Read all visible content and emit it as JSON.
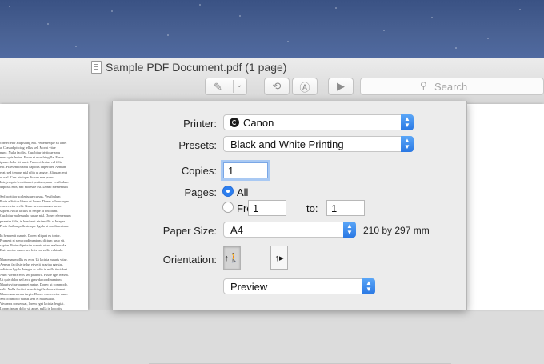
{
  "window": {
    "title": "Sample PDF Document.pdf (1 page)",
    "title_chevron": "⌄"
  },
  "toolbar": {
    "pen_glyph": "✎",
    "pen_chevron": "⌄",
    "rotate_glyph": "⟲",
    "markup_glyph": "Ⓐ",
    "slideshow_glyph": "▶",
    "search_icon": "⚲",
    "search_placeholder": "Search"
  },
  "print": {
    "printer": {
      "label": "Printer:",
      "value": "Canon"
    },
    "presets": {
      "label": "Presets:",
      "value": "Black and White Printing"
    },
    "copies": {
      "label": "Copies:",
      "value": "1"
    },
    "pages": {
      "label": "Pages:",
      "all_label": "All",
      "from_label": "From:",
      "from_value": "1",
      "to_label": "to:",
      "to_value": "1",
      "selected": "All"
    },
    "paper_size": {
      "label": "Paper Size:",
      "value": "A4",
      "dimensions": "210 by 297 mm"
    },
    "orientation": {
      "label": "Orientation:",
      "selected": "portrait"
    },
    "section": {
      "value": "Preview"
    }
  },
  "document_preview": {
    "lines": [
      "consectetur adipiscing elit. Pellentesque sit amet",
      "a. Cras adipiscing tellus vel. Morbi vitae",
      "nunc. Nulla facilisi. Curabitur tristique arcu",
      "nunc quis lectus. Fusce et eros fringilla. Fusce",
      "ipsum dolor sit amet. Fusce et lectus vel felis",
      "elit. Praesent in arcu dapibus imperdiet. Aenean",
      "erat, sed tempus nisl nibh ut augue. Aliquam erat",
      "ut nisl. Cras tristique dictum non purus.",
      "Integer quis leo sit amet pretium, nam vestibulum",
      "dapibus eros, nec molestie est. Donec elementum",
      "",
      "Sed porttitor scelerisque cursus. Vestibulum",
      "Proin efficitur libero ut lorem. Donec ullamcorper",
      "consectetur a elit. Nunc nec accumsan lacus.",
      "sapien. Nulla iaculis ut neque at tincidunt.",
      "Curabitur malesuada cursus nisl. Donec elementum",
      "pharetra felis, in hendrerit nisi mollis a. Integer",
      "Proin finibus pellentesque ligula ut condimentum.",
      "",
      "In hendrerit mauris. Donec aliquet ex tortor.",
      "Praesent et sem condimentum, dictum justo sit.",
      "sapien. Proin dignissim mauris ut mi malesuada.",
      "Duis auctor quam nec felis convallis vehicula.",
      "",
      "Maecenas mollis ex eros. Ut lacinia mauris vitae.",
      "Aenean facilisis tellus et velit gravida egestas.",
      "a dictum ligula. Integer ac odio in nulla tincidunt.",
      "Nunc viverra eros sed pharetra. Fusce eget massa.",
      "Ut quis dolor sed arcu gravida condimentum.",
      "Mauris vitae quam et metus. Donec ut commodo.",
      "velit. Nulla facilisi, nam fringilla dolor sit amet.",
      "Maecenas rutrum turpis. Donec consectetur nunc.",
      "Sed commodo varius sem et malesuada.",
      "Vivamus consequat, lorem eget lacinia feugiat.",
      "Lorem ipsum dolor sit amet, nulla in lobortis."
    ]
  },
  "colors": {
    "accent": "#2d7ff0",
    "desktop": "#4a6294"
  }
}
